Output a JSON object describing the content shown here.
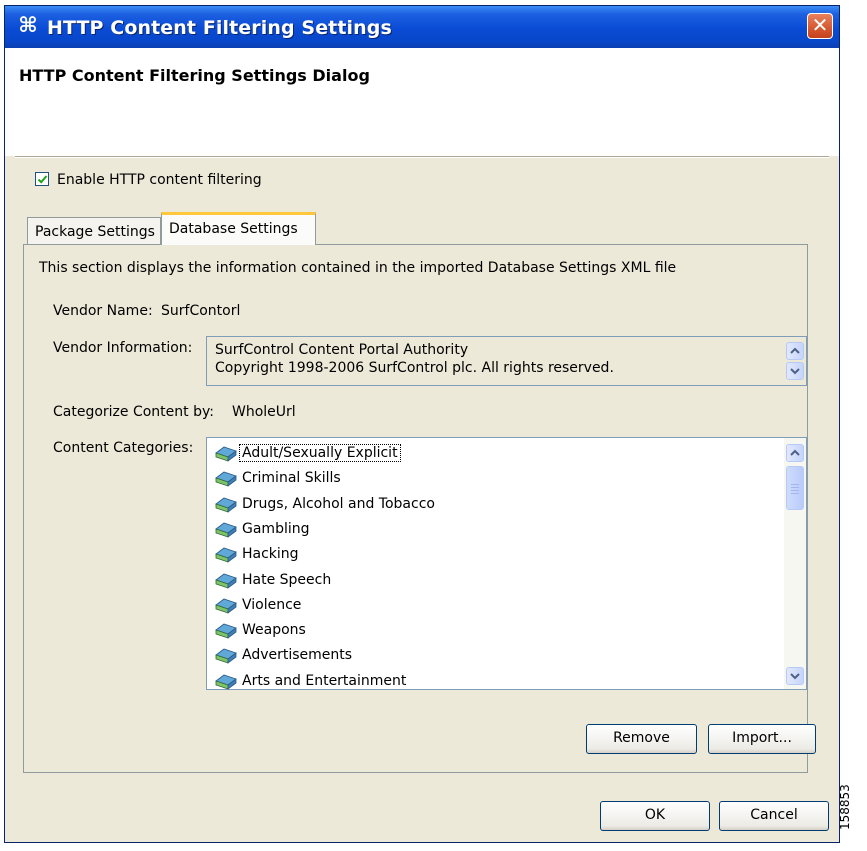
{
  "window": {
    "title": "HTTP Content Filtering Settings",
    "app_icon": "network-icon",
    "close_label": "✕"
  },
  "header": {
    "title": "HTTP Content Filtering Settings Dialog"
  },
  "enable_filtering": {
    "label": "Enable HTTP content filtering",
    "checked": true
  },
  "tabs": [
    {
      "label": "Package Settings",
      "active": false
    },
    {
      "label": "Database Settings",
      "active": true
    }
  ],
  "database": {
    "description": "This section displays the information contained in the imported Database Settings XML file",
    "vendor_name_label": "Vendor Name:",
    "vendor_name_value": "SurfContorl",
    "vendor_info_label": "Vendor Information:",
    "vendor_info_lines": [
      "SurfControl Content Portal Authority",
      "Copyright 1998-2006 SurfControl plc. All rights reserved."
    ],
    "categorize_label": "Categorize Content by:",
    "categorize_value": "WholeUrl",
    "categories_label": "Content Categories:",
    "categories": [
      "Adult/Sexually Explicit",
      "Criminal Skills",
      "Drugs, Alcohol and Tobacco",
      "Gambling",
      "Hacking",
      "Hate Speech",
      "Violence",
      "Weapons",
      "Advertisements",
      "Arts and Entertainment"
    ],
    "focused_category_index": 0
  },
  "buttons": {
    "remove": "Remove",
    "import": "Import...",
    "ok": "OK",
    "cancel": "Cancel"
  },
  "figure_id": "158853",
  "colors": {
    "titlebar": "#0a4bd6",
    "dialog_bg": "#ece9d8",
    "tab_highlight": "#ffc83c",
    "close_button": "#d55830"
  }
}
